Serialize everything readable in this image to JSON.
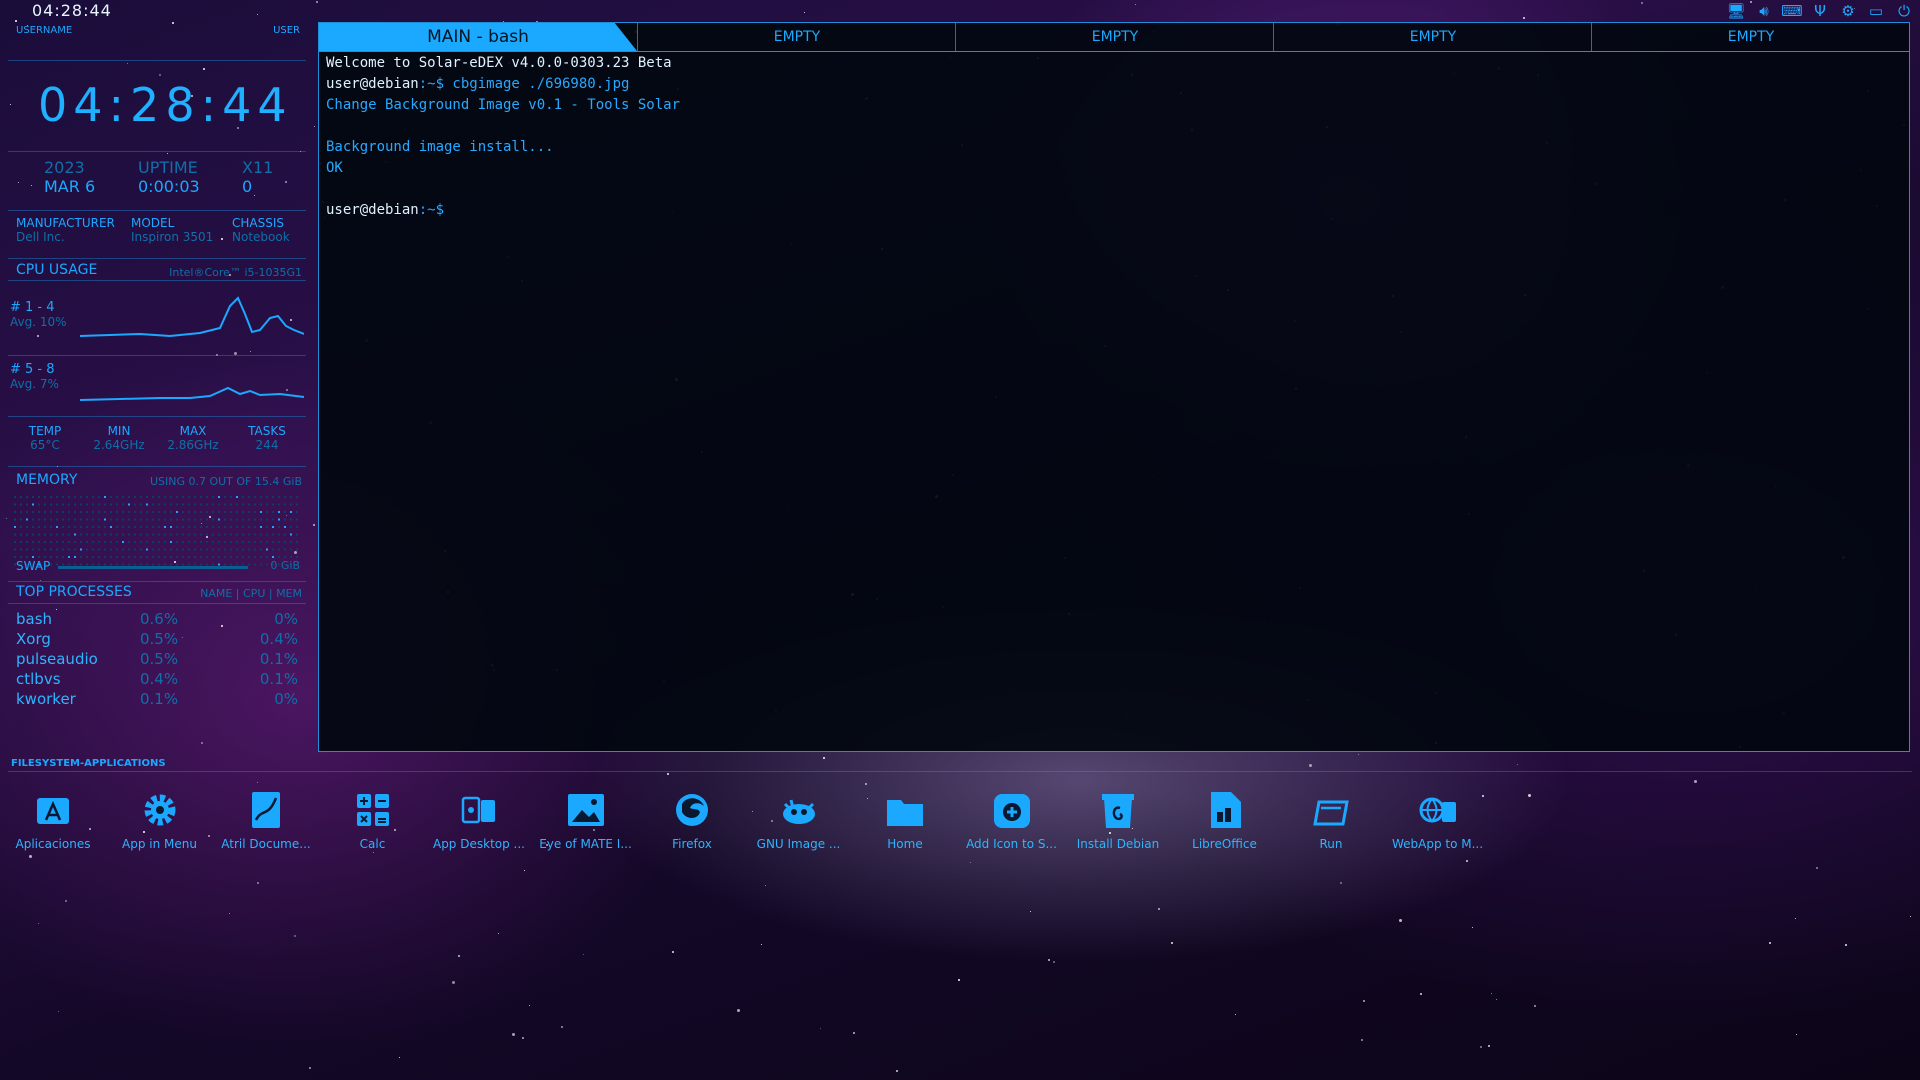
{
  "top_bar": {
    "clock": "04:28:44",
    "tray_icons": [
      "monitor-icon",
      "volume-icon",
      "keyboard-icon",
      "usb-icon",
      "settings-icon",
      "battery-icon",
      "power-icon"
    ]
  },
  "user": {
    "label_left": "USERNAME",
    "label_right": "USER"
  },
  "clock": {
    "h": "04",
    "m": "28",
    "s": "44"
  },
  "system": {
    "year": "2023",
    "date": "MAR 6",
    "uptime_label": "UPTIME",
    "uptime": "0:00:03",
    "x11_label": "X11",
    "x11": "0"
  },
  "hardware": {
    "manufacturer_label": "MANUFACTURER",
    "manufacturer": "Dell Inc.",
    "model_label": "MODEL",
    "model": "Inspiron 3501",
    "chassis_label": "CHASSIS",
    "chassis": "Notebook"
  },
  "cpu": {
    "title": "CPU USAGE",
    "model": "Intel®Core™ i5-1035G1",
    "group1": {
      "label": "# 1 - 4",
      "avg": "Avg. 10%"
    },
    "group2": {
      "label": "# 5 - 8",
      "avg": "Avg. 7%"
    },
    "temp_label": "TEMP",
    "temp": "65°C",
    "min_label": "MIN",
    "min": "2.64GHz",
    "max_label": "MAX",
    "max": "2.86GHz",
    "tasks_label": "TASKS",
    "tasks": "244"
  },
  "memory": {
    "title": "MEMORY",
    "usage": "USING 0.7 OUT OF 15.4 GiB",
    "swap_label": "SWAP",
    "swap_value": "0 GiB"
  },
  "processes": {
    "title": "TOP PROCESSES",
    "columns": "NAME | CPU | MEM",
    "rows": [
      {
        "name": "bash",
        "cpu": "0.6%",
        "mem": "0%"
      },
      {
        "name": "Xorg",
        "cpu": "0.5%",
        "mem": "0.4%"
      },
      {
        "name": "pulseaudio",
        "cpu": "0.5%",
        "mem": "0.1%"
      },
      {
        "name": "ctlbvs",
        "cpu": "0.4%",
        "mem": "0.1%"
      },
      {
        "name": "kworker",
        "cpu": "0.1%",
        "mem": "0%"
      }
    ]
  },
  "terminal": {
    "tabs": [
      "MAIN - bash",
      "EMPTY",
      "EMPTY",
      "EMPTY",
      "EMPTY"
    ],
    "lines": [
      {
        "prompt": "",
        "text": "Welcome to Solar-eDEX v4.0.0-0303.23 Beta"
      },
      {
        "prompt": "user@debian",
        "text": ":~$ cbgimage ./696980.jpg"
      },
      {
        "prompt": "",
        "text": "Change Background Image v0.1 - Tools Solar"
      },
      {
        "prompt": "",
        "text": ""
      },
      {
        "prompt": "",
        "text": "Background image install..."
      },
      {
        "prompt": "",
        "text": "OK"
      },
      {
        "prompt": "",
        "text": ""
      },
      {
        "prompt": "user@debian",
        "text": ":~$"
      }
    ]
  },
  "filesystem": {
    "title": "FILESYSTEM-APPLICATIONS",
    "apps": [
      {
        "label": "Aplicaciones",
        "icon": "app-store-icon"
      },
      {
        "label": "App in Menu",
        "icon": "gear-icon"
      },
      {
        "label": "Atril Docume...",
        "icon": "document-viewer-icon"
      },
      {
        "label": "Calc",
        "icon": "calculator-icon"
      },
      {
        "label": "App Desktop ...",
        "icon": "app-desktop-icon"
      },
      {
        "label": "Eye of MATE I...",
        "icon": "image-viewer-icon"
      },
      {
        "label": "Firefox",
        "icon": "firefox-icon"
      },
      {
        "label": "GNU Image ...",
        "icon": "gimp-icon"
      },
      {
        "label": "Home",
        "icon": "folder-icon"
      },
      {
        "label": "Add Icon to S...",
        "icon": "add-icon-icon"
      },
      {
        "label": "Install Debian",
        "icon": "debian-installer-icon"
      },
      {
        "label": "LibreOffice",
        "icon": "libreoffice-icon"
      },
      {
        "label": "Run",
        "icon": "run-icon"
      },
      {
        "label": "WebApp to M...",
        "icon": "webapp-icon"
      }
    ]
  },
  "colors": {
    "accent": "#1ba8ff",
    "dim": "#0f6fa8",
    "terminal_bg": "#02080f"
  }
}
